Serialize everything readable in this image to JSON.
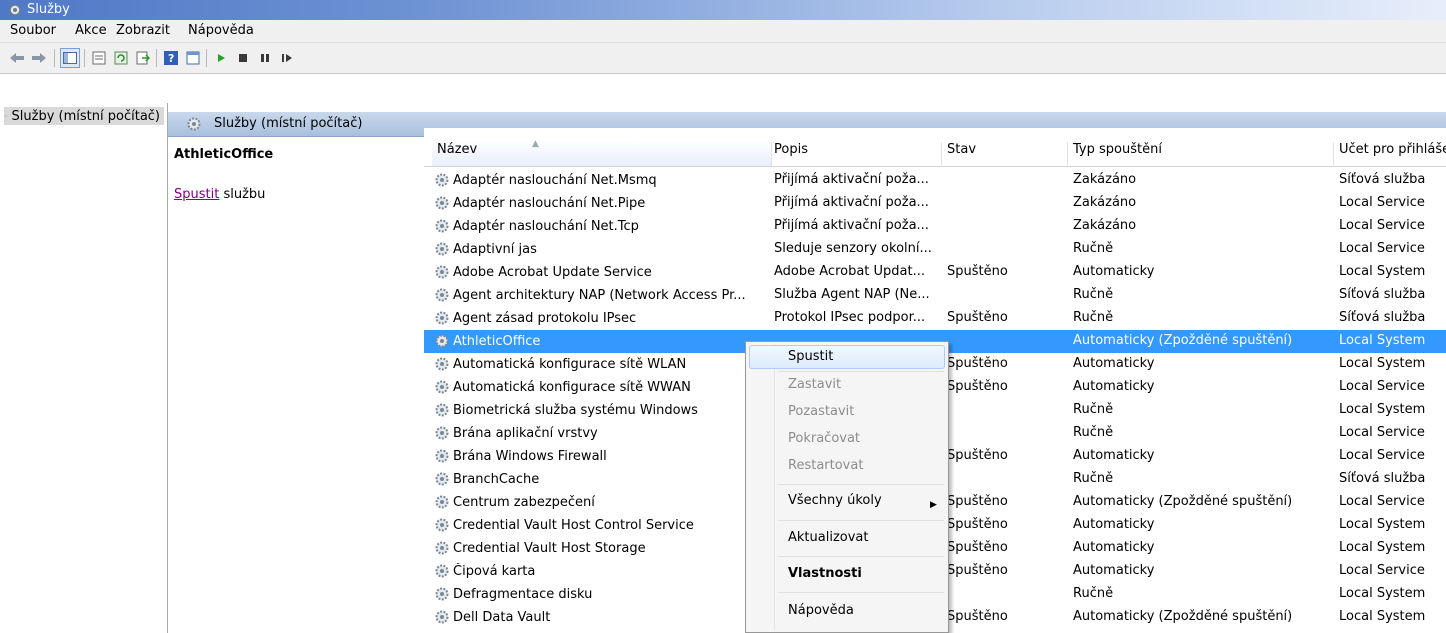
{
  "window": {
    "title": "Služby"
  },
  "menu": [
    "Soubor",
    "Akce",
    "Zobrazit",
    "Nápověda"
  ],
  "tree": {
    "root": "Služby (místní počítač)"
  },
  "pane": {
    "header": "Služby (místní počítač)",
    "service_name": "AthleticOffice",
    "action_link": "Spustit",
    "action_suffix": " službu"
  },
  "columns": [
    "Název",
    "Popis",
    "Stav",
    "Typ spouštění",
    "Účet pro přihlášení"
  ],
  "rows": [
    {
      "name": "Adaptér naslouchání Net.Msmq",
      "desc": "Přijímá aktivační poža...",
      "state": "",
      "start": "Zakázáno",
      "acct": "Síťová služba"
    },
    {
      "name": "Adaptér naslouchání Net.Pipe",
      "desc": "Přijímá aktivační poža...",
      "state": "",
      "start": "Zakázáno",
      "acct": "Local Service"
    },
    {
      "name": "Adaptér naslouchání Net.Tcp",
      "desc": "Přijímá aktivační poža...",
      "state": "",
      "start": "Zakázáno",
      "acct": "Local Service"
    },
    {
      "name": "Adaptivní jas",
      "desc": "Sleduje senzory okolní...",
      "state": "",
      "start": "Ručně",
      "acct": "Local Service"
    },
    {
      "name": "Adobe Acrobat Update Service",
      "desc": "Adobe Acrobat Updat...",
      "state": "Spuštěno",
      "start": "Automaticky",
      "acct": "Local System"
    },
    {
      "name": "Agent architektury NAP (Network Access Pr...",
      "desc": "Služba Agent NAP (Ne...",
      "state": "",
      "start": "Ručně",
      "acct": "Síťová služba"
    },
    {
      "name": "Agent zásad protokolu IPsec",
      "desc": "Protokol IPsec podpor...",
      "state": "Spuštěno",
      "start": "Ručně",
      "acct": "Síťová služba"
    },
    {
      "name": "AthleticOffice",
      "desc": "",
      "state": "",
      "start": "Automaticky (Zpožděné spuštění)",
      "acct": "Local System"
    },
    {
      "name": "Automatická konfigurace sítě WLAN",
      "desc": "",
      "state": "Spuštěno",
      "start": "Automaticky",
      "acct": "Local System"
    },
    {
      "name": "Automatická konfigurace sítě WWAN",
      "desc": "",
      "state": "Spuštěno",
      "start": "Automaticky",
      "acct": "Local Service"
    },
    {
      "name": "Biometrická služba systému Windows",
      "desc": "",
      "state": "",
      "start": "Ručně",
      "acct": "Local System"
    },
    {
      "name": "Brána aplikační vrstvy",
      "desc": "",
      "state": "",
      "start": "Ručně",
      "acct": "Local Service"
    },
    {
      "name": "Brána Windows Firewall",
      "desc": "",
      "state": "Spuštěno",
      "start": "Automaticky",
      "acct": "Local Service"
    },
    {
      "name": "BranchCache",
      "desc": "",
      "state": "",
      "start": "Ručně",
      "acct": "Síťová služba"
    },
    {
      "name": "Centrum zabezpečení",
      "desc": "",
      "state": "Spuštěno",
      "start": "Automaticky (Zpožděné spuštění)",
      "acct": "Local Service"
    },
    {
      "name": "Credential Vault Host Control Service",
      "desc": "",
      "state": "Spuštěno",
      "start": "Automaticky",
      "acct": "Local System"
    },
    {
      "name": "Credential Vault Host Storage",
      "desc": "",
      "state": "Spuštěno",
      "start": "Automaticky",
      "acct": "Local System"
    },
    {
      "name": "Čipová karta",
      "desc": "",
      "state": "Spuštěno",
      "start": "Automaticky",
      "acct": "Local Service"
    },
    {
      "name": "Defragmentace disku",
      "desc": "",
      "state": "",
      "start": "Ručně",
      "acct": "Local System"
    },
    {
      "name": "Dell Data Vault",
      "desc": "",
      "state": "Spuštěno",
      "start": "Automaticky (Zpožděné spuštění)",
      "acct": "Local System"
    }
  ],
  "context_menu": {
    "start": "Spustit",
    "stop": "Zastavit",
    "pause": "Pozastavit",
    "resume": "Pokračovat",
    "restart": "Restartovat",
    "all_tasks": "Všechny úkoly",
    "refresh": "Aktualizovat",
    "properties": "Vlastnosti",
    "help": "Nápověda"
  },
  "colors": {
    "selection": "#3399ff",
    "link": "#800080"
  }
}
